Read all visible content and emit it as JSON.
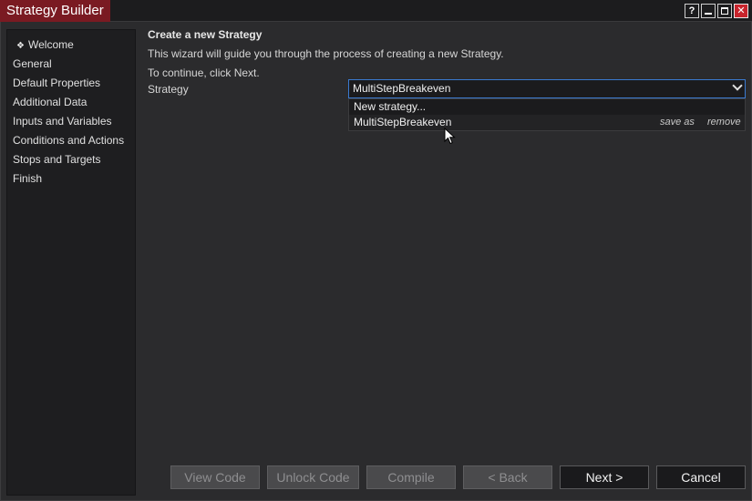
{
  "window": {
    "title": "Strategy Builder",
    "buttons": {
      "help": "?",
      "close": "✕"
    }
  },
  "sidebar": {
    "items": [
      {
        "label": "Welcome",
        "active": true
      },
      {
        "label": "General"
      },
      {
        "label": "Default Properties"
      },
      {
        "label": "Additional Data"
      },
      {
        "label": "Inputs and Variables"
      },
      {
        "label": "Conditions and Actions"
      },
      {
        "label": "Stops and Targets"
      },
      {
        "label": "Finish"
      }
    ],
    "bullet": "❖"
  },
  "main": {
    "heading": "Create a new Strategy",
    "description": "This wizard will guide you through the process of creating a new Strategy.",
    "instruction": "To continue, click Next.",
    "strategy_label": "Strategy",
    "strategy_value": "MultiStepBreakeven",
    "dropdown": {
      "options": [
        "New strategy...",
        "MultiStepBreakeven"
      ],
      "save_as": "save as",
      "remove": "remove"
    }
  },
  "footer": {
    "view_code": "View Code",
    "unlock_code": "Unlock Code",
    "compile": "Compile",
    "back": "< Back",
    "next": "Next >",
    "cancel": "Cancel"
  },
  "colors": {
    "title_accent": "#7a1a22",
    "close_button": "#c8242c",
    "focus_border": "#3a7ad0"
  }
}
